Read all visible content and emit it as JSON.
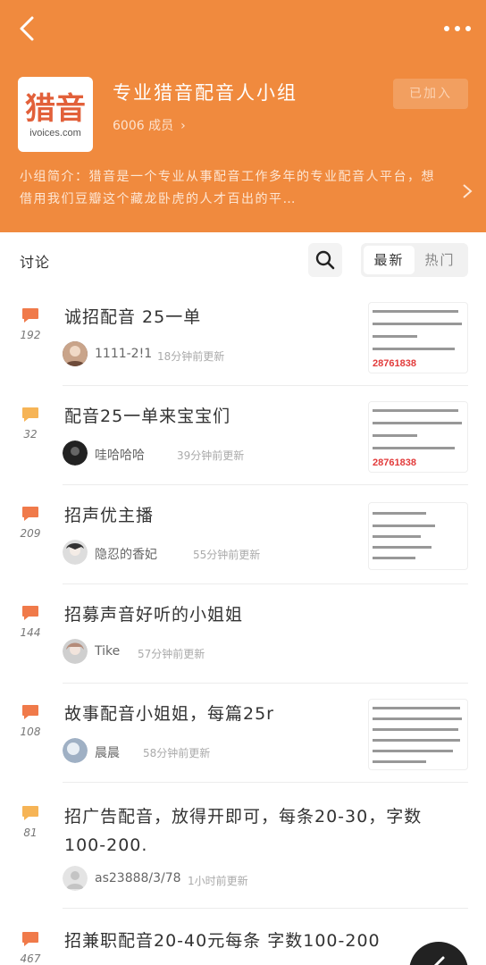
{
  "header": {
    "back_icon": "chevron-left-icon",
    "more_icon": "more-dots-icon",
    "logo": {
      "main": "猎音",
      "sub": "ivoices.com"
    },
    "group_name": "专业猎音配音人小组",
    "member_count": "6006 成员",
    "joined_label": "已加入",
    "intro": "小组简介：猎音是一个专业从事配音工作多年的专业配音人平台，想借用我们豆瓣这个藏龙卧虎的人才百出的平…",
    "background_color": "#f08a3e"
  },
  "toolbar": {
    "section_title": "讨论",
    "search_icon": "search-icon",
    "tabs": [
      {
        "label": "最新",
        "active": true
      },
      {
        "label": "热门",
        "active": false
      }
    ]
  },
  "posts": [
    {
      "title": "诚招配音 25一单",
      "count": "192",
      "author": "1111-2!1",
      "time": "18分钟前更新",
      "has_thumb": true
    },
    {
      "title": "配音25一单来宝宝们",
      "count": "32",
      "author": "哇哈哈哈",
      "time": "39分钟前更新",
      "has_thumb": true
    },
    {
      "title": "招声优主播",
      "count": "209",
      "author": "隐忍的香妃",
      "time": "55分钟前更新",
      "has_thumb": true
    },
    {
      "title": "招募声音好听的小姐姐",
      "count": "144",
      "author": "Tike",
      "time": "57分钟前更新",
      "has_thumb": false
    },
    {
      "title": "故事配音小姐姐，每篇25r",
      "count": "108",
      "author": "晨晨",
      "time": "58分钟前更新",
      "has_thumb": true
    },
    {
      "title_line1": "招广告配音，放得开即可，每条20-30，字数",
      "title_line2": "100-200.",
      "count": "81",
      "author": "as23888/3/78",
      "time": "1小时前更新",
      "has_thumb": false
    },
    {
      "title": "招兼职配音20-40元每条 字数100-200",
      "count": "467"
    }
  ],
  "thumb_text": {
    "phone": "28761838"
  },
  "fab_icon": "pen-icon"
}
